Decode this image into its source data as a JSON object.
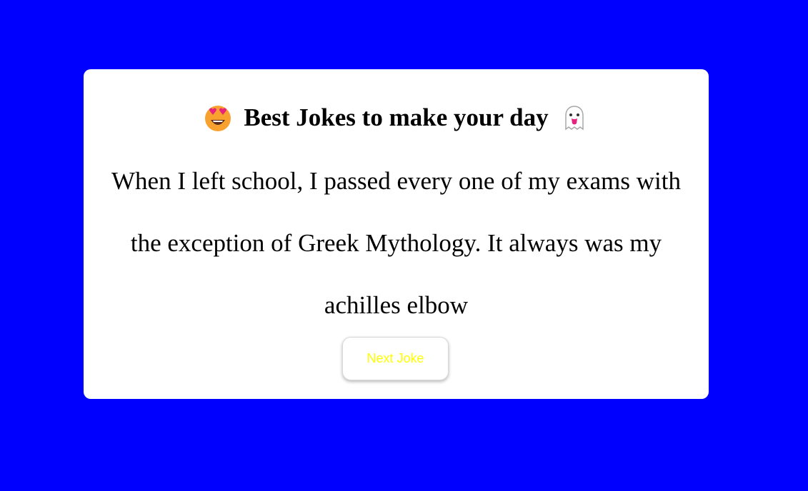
{
  "page": {
    "background_color": "#0000ff"
  },
  "card": {
    "title": "Best Jokes to make your day",
    "title_left_icon": "heart-eyes-emoji-icon",
    "title_right_icon": "ghost-emoji-icon",
    "joke_text": "When I left school, I passed every one of my exams with the exception of Greek Mythology. It always was my achilles elbow",
    "button_label": "Next Joke",
    "button_text_color": "#ffff00"
  }
}
